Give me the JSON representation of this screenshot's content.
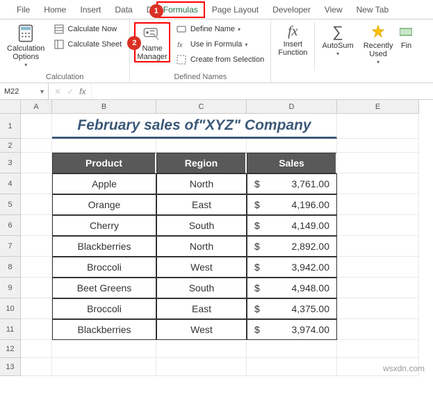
{
  "tabs": [
    "File",
    "Home",
    "Insert",
    "Data",
    "Draw",
    "Formulas",
    "Page Layout",
    "Developer",
    "View",
    "New Tab"
  ],
  "active_tab": "Formulas",
  "highlighted_tab": "Formulas",
  "ribbon": {
    "calculation": {
      "label": "Calculation",
      "calc_options": "Calculation\nOptions",
      "calc_now": "Calculate Now",
      "calc_sheet": "Calculate Sheet"
    },
    "defined_names": {
      "label": "Defined Names",
      "name_manager": "Name\nManager",
      "define_name": "Define Name",
      "use_in_formula": "Use in Formula",
      "create_from_selection": "Create from Selection"
    },
    "function": {
      "insert_function": "Insert\nFunction",
      "autosum": "AutoSum",
      "recently_used": "Recently\nUsed",
      "fin": "Fin"
    }
  },
  "name_box": "M22",
  "columns": [
    "A",
    "B",
    "C",
    "D",
    "E"
  ],
  "rows": [
    "1",
    "2",
    "3",
    "4",
    "5",
    "6",
    "7",
    "8",
    "9",
    "10",
    "11",
    "12",
    "13"
  ],
  "title": "February sales of\"XYZ\" Company",
  "table": {
    "headers": [
      "Product",
      "Region",
      "Sales"
    ],
    "rows": [
      {
        "product": "Apple",
        "region": "North",
        "currency": "$",
        "amount": "3,761.00"
      },
      {
        "product": "Orange",
        "region": "East",
        "currency": "$",
        "amount": "4,196.00"
      },
      {
        "product": "Cherry",
        "region": "South",
        "currency": "$",
        "amount": "4,149.00"
      },
      {
        "product": "Blackberries",
        "region": "North",
        "currency": "$",
        "amount": "2,892.00"
      },
      {
        "product": "Broccoli",
        "region": "West",
        "currency": "$",
        "amount": "3,942.00"
      },
      {
        "product": "Beet Greens",
        "region": "South",
        "currency": "$",
        "amount": "4,948.00"
      },
      {
        "product": "Broccoli",
        "region": "East",
        "currency": "$",
        "amount": "4,375.00"
      },
      {
        "product": "Blackberries",
        "region": "West",
        "currency": "$",
        "amount": "3,974.00"
      }
    ]
  },
  "watermark": "wsxdn.com",
  "annotations": {
    "badge1": "1",
    "badge2": "2"
  }
}
